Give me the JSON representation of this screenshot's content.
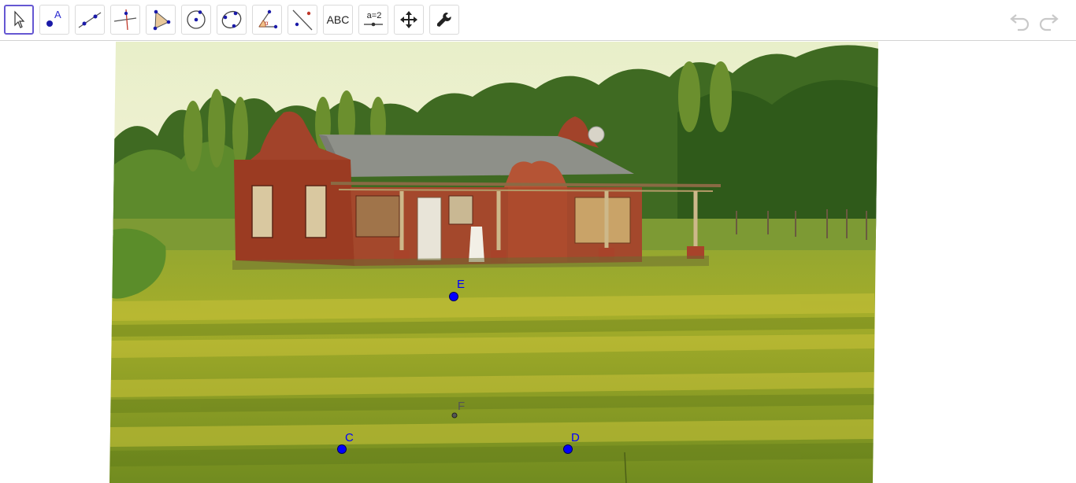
{
  "toolbar": {
    "tools": [
      {
        "name": "move-tool",
        "selected": true
      },
      {
        "name": "point-tool"
      },
      {
        "name": "line-tool"
      },
      {
        "name": "perpendicular-line-tool"
      },
      {
        "name": "polygon-tool"
      },
      {
        "name": "circle-center-point-tool"
      },
      {
        "name": "conic-through-points-tool"
      },
      {
        "name": "angle-tool"
      },
      {
        "name": "reflect-about-line-tool"
      },
      {
        "name": "text-tool",
        "label": "ABC"
      },
      {
        "name": "slider-tool",
        "label": "a=2"
      },
      {
        "name": "move-graphics-view-tool"
      },
      {
        "name": "settings-tool"
      }
    ],
    "undo_icon": "undo-icon",
    "redo_icon": "redo-icon"
  },
  "points": [
    {
      "label": "E",
      "color": "#0000ff"
    },
    {
      "label": "F",
      "color": "#555555"
    },
    {
      "label": "C",
      "color": "#0000ff"
    },
    {
      "label": "D",
      "color": "#0000ff"
    }
  ],
  "image": {
    "subject": "brick house with porch on green lawn",
    "icon": "background-photo"
  }
}
